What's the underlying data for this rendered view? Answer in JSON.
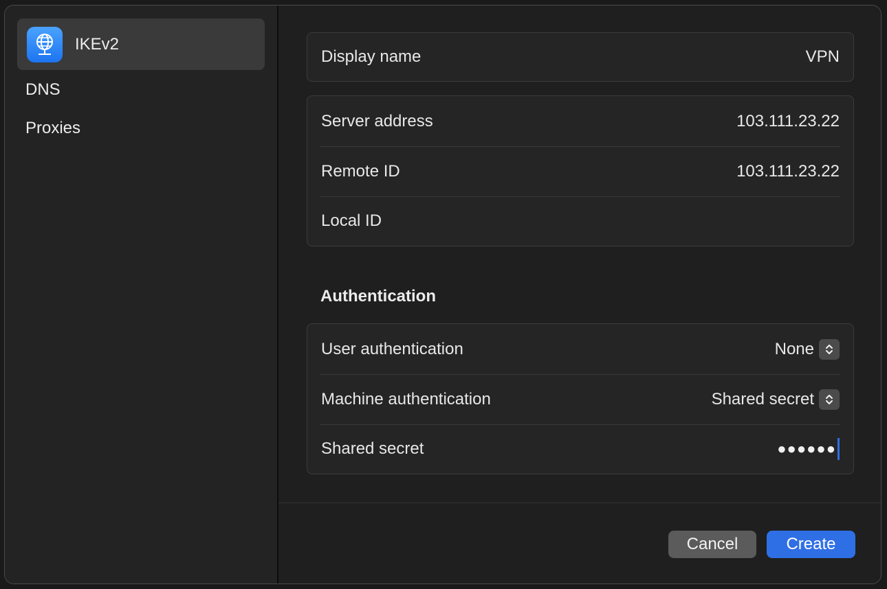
{
  "sidebar": {
    "items": [
      {
        "label": "IKEv2",
        "icon": "vpn-globe-icon",
        "selected": true
      },
      {
        "label": "DNS"
      },
      {
        "label": "Proxies"
      }
    ]
  },
  "general": {
    "display_name": {
      "label": "Display name",
      "value": "VPN"
    }
  },
  "server": {
    "server_address": {
      "label": "Server address",
      "value": "103.111.23.22"
    },
    "remote_id": {
      "label": "Remote ID",
      "value": "103.111.23.22"
    },
    "local_id": {
      "label": "Local ID",
      "value": ""
    }
  },
  "authentication": {
    "title": "Authentication",
    "user_auth": {
      "label": "User authentication",
      "value": "None"
    },
    "machine_auth": {
      "label": "Machine authentication",
      "value": "Shared secret"
    },
    "shared_secret": {
      "label": "Shared secret",
      "value": "●●●●●●"
    }
  },
  "footer": {
    "cancel_label": "Cancel",
    "create_label": "Create"
  },
  "colors": {
    "accent": "#2f6fe6",
    "window_bg": "#1f1f1f",
    "sidebar_bg": "#232323",
    "selected_bg": "#3a3a3a"
  }
}
